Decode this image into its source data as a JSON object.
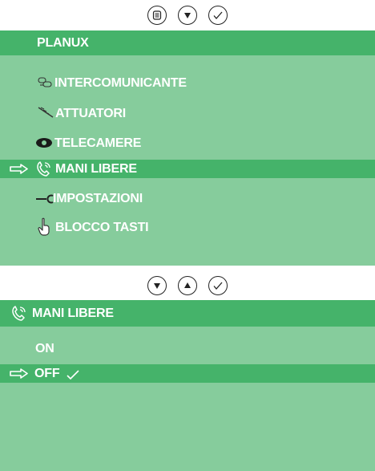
{
  "top_controls": [
    {
      "name": "menu",
      "icon": "menu-icon"
    },
    {
      "name": "down",
      "icon": "arrow-down-icon"
    },
    {
      "name": "confirm",
      "icon": "checkmark-icon"
    }
  ],
  "mid_controls": [
    {
      "name": "down",
      "icon": "arrow-down-icon"
    },
    {
      "name": "up",
      "icon": "arrow-up-icon"
    },
    {
      "name": "confirm",
      "icon": "checkmark-icon"
    }
  ],
  "menu": {
    "title": "PLANUX",
    "items": [
      {
        "label": "INTERCOMUNICANTE",
        "icon": "intercom-icon",
        "selected": false
      },
      {
        "label": "ATTUATORI",
        "icon": "actuator-icon",
        "selected": false
      },
      {
        "label": "TELECAMERE",
        "icon": "camera-icon",
        "selected": false
      },
      {
        "label": "MANI LIBERE",
        "icon": "handsfree-phone-icon",
        "selected": true
      },
      {
        "label": "IMPOSTAZIONI",
        "icon": "wrench-icon",
        "selected": false
      },
      {
        "label": "BLOCCO TASTI",
        "icon": "hand-pointer-icon",
        "selected": false
      }
    ]
  },
  "submenu": {
    "title": "MANI LIBERE",
    "title_icon": "handsfree-phone-icon",
    "options": [
      {
        "label": "ON",
        "selected": false
      },
      {
        "label": "OFF",
        "selected": true,
        "checked": true
      }
    ]
  },
  "colors": {
    "panel": "#86cc9c",
    "highlight": "#45b36a",
    "text": "#ffffff"
  }
}
